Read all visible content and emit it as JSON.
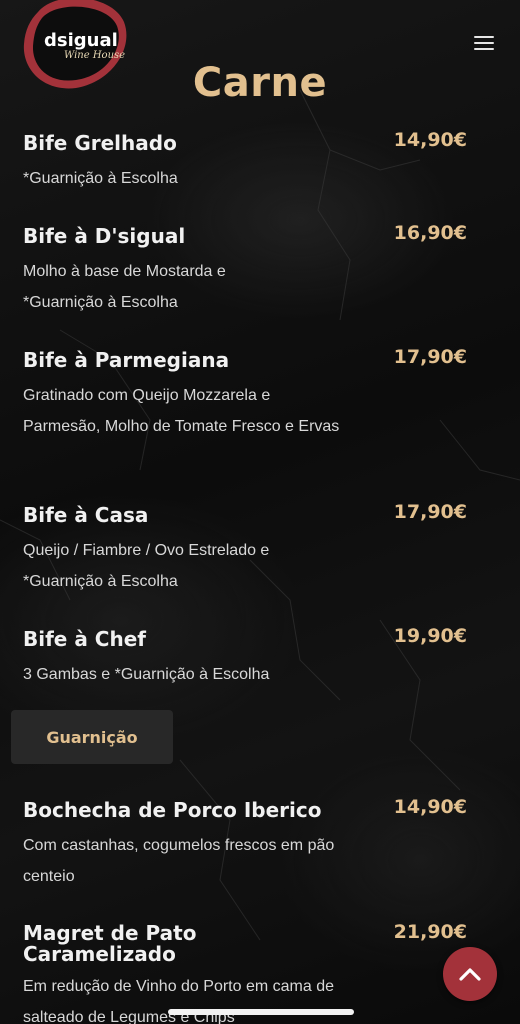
{
  "brand": {
    "name": "dsigual",
    "tagline": "Wine House",
    "accent": "#a3323a",
    "gold": "#e2c08f"
  },
  "header": {
    "menu_icon": "hamburger-icon"
  },
  "page": {
    "title": "Carne"
  },
  "items": [
    {
      "name": "Bife Grelhado",
      "price": "14,90€",
      "desc": "*Guarnição à Escolha"
    },
    {
      "name": "Bife à D'sigual",
      "price": "16,90€",
      "desc": "Molho à base de Mostarda e *Guarnição à Escolha"
    },
    {
      "name": "Bife à Parmegiana",
      "price": "17,90€",
      "desc": "Gratinado com Queijo Mozzarela e Parmesão, Molho de Tomate Fresco e Ervas"
    },
    {
      "name": "Bife à Casa",
      "price": "17,90€",
      "desc": "Queijo / Fiambre / Ovo Estrelado e *Guarnição à Escolha"
    },
    {
      "name": "Bife à Chef",
      "price": "19,90€",
      "desc": "3 Gambas e *Guarnição à Escolha"
    },
    {
      "name": "Bochecha de Porco Iberico",
      "price": "14,90€",
      "desc": "Com castanhas, cogumelos frescos em pão centeio"
    },
    {
      "name": "Magret de Pato Caramelizado",
      "price": "21,90€",
      "desc": "Em redução de Vinho do Porto em cama de salteado de Legumes e Chips"
    }
  ],
  "section_button": {
    "label": "Guarnição"
  },
  "scroll_top": {
    "icon": "chevron-up-icon"
  }
}
